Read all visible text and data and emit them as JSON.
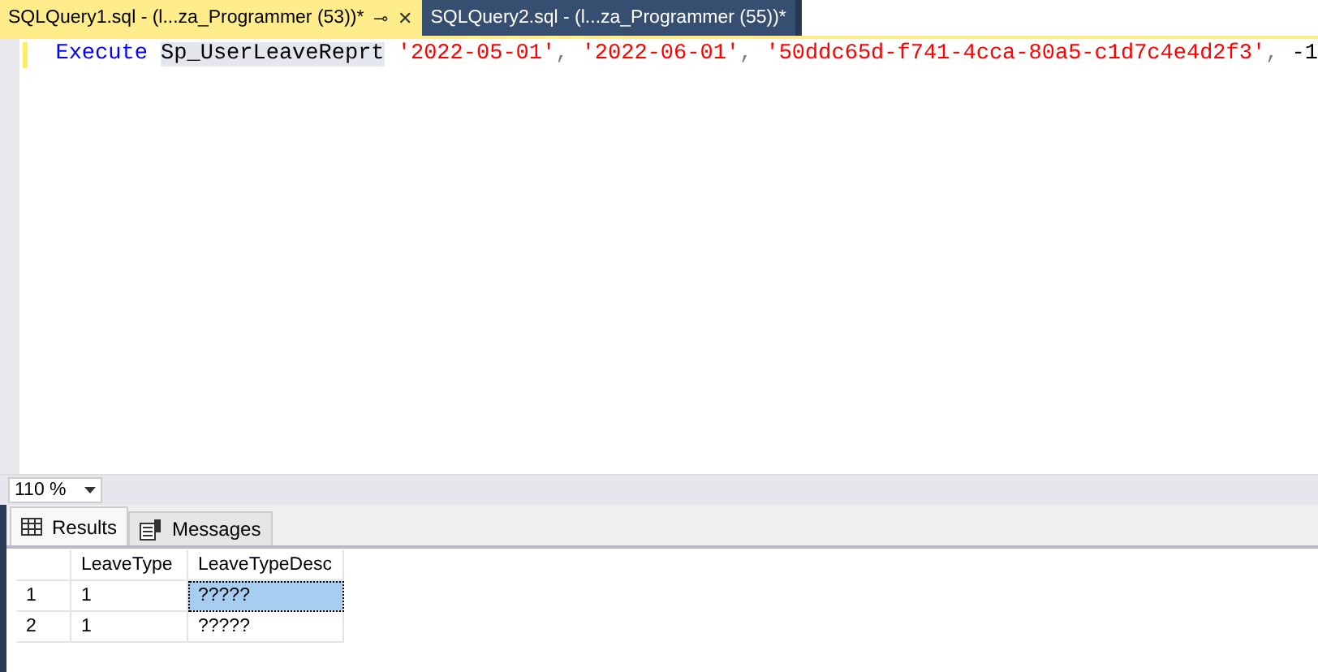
{
  "doc_tabs": [
    {
      "label": "SQLQuery1.sql - (l...za_Programmer (53))*",
      "selected": true,
      "pin": "⊸",
      "close": "✕"
    },
    {
      "label": "SQLQuery2.sql - (l...za_Programmer (55))*",
      "selected": false
    }
  ],
  "code_line": [
    {
      "kind": "keyword",
      "text": "Execute "
    },
    {
      "kind": "ident",
      "text": "Sp_UserLeaveReprt"
    },
    {
      "kind": "string",
      "text": " '2022-05-01'"
    },
    {
      "kind": "punct",
      "text": ", "
    },
    {
      "kind": "string",
      "text": "'2022-06-01'"
    },
    {
      "kind": "punct",
      "text": ", "
    },
    {
      "kind": "string",
      "text": "'50ddc65d-f741-4cca-80a5-c1d7c4e4d2f3'"
    },
    {
      "kind": "punct",
      "text": ", "
    },
    {
      "kind": "plain",
      "text": "-1"
    }
  ],
  "zoom": {
    "value": "110 %"
  },
  "result_tabs": [
    {
      "label": "Results",
      "kind": "grid",
      "selected": true
    },
    {
      "label": "Messages",
      "kind": "messages",
      "selected": false
    }
  ],
  "table": {
    "columns": [
      "LeaveType",
      "LeaveTypeDesc"
    ],
    "rows": [
      {
        "number": "1",
        "cells": [
          {
            "text": "1",
            "selected": false
          },
          {
            "text": "?????",
            "selected": true
          }
        ]
      },
      {
        "number": "2",
        "cells": [
          {
            "text": "1",
            "selected": false
          },
          {
            "text": "?????",
            "selected": false
          }
        ]
      }
    ]
  }
}
